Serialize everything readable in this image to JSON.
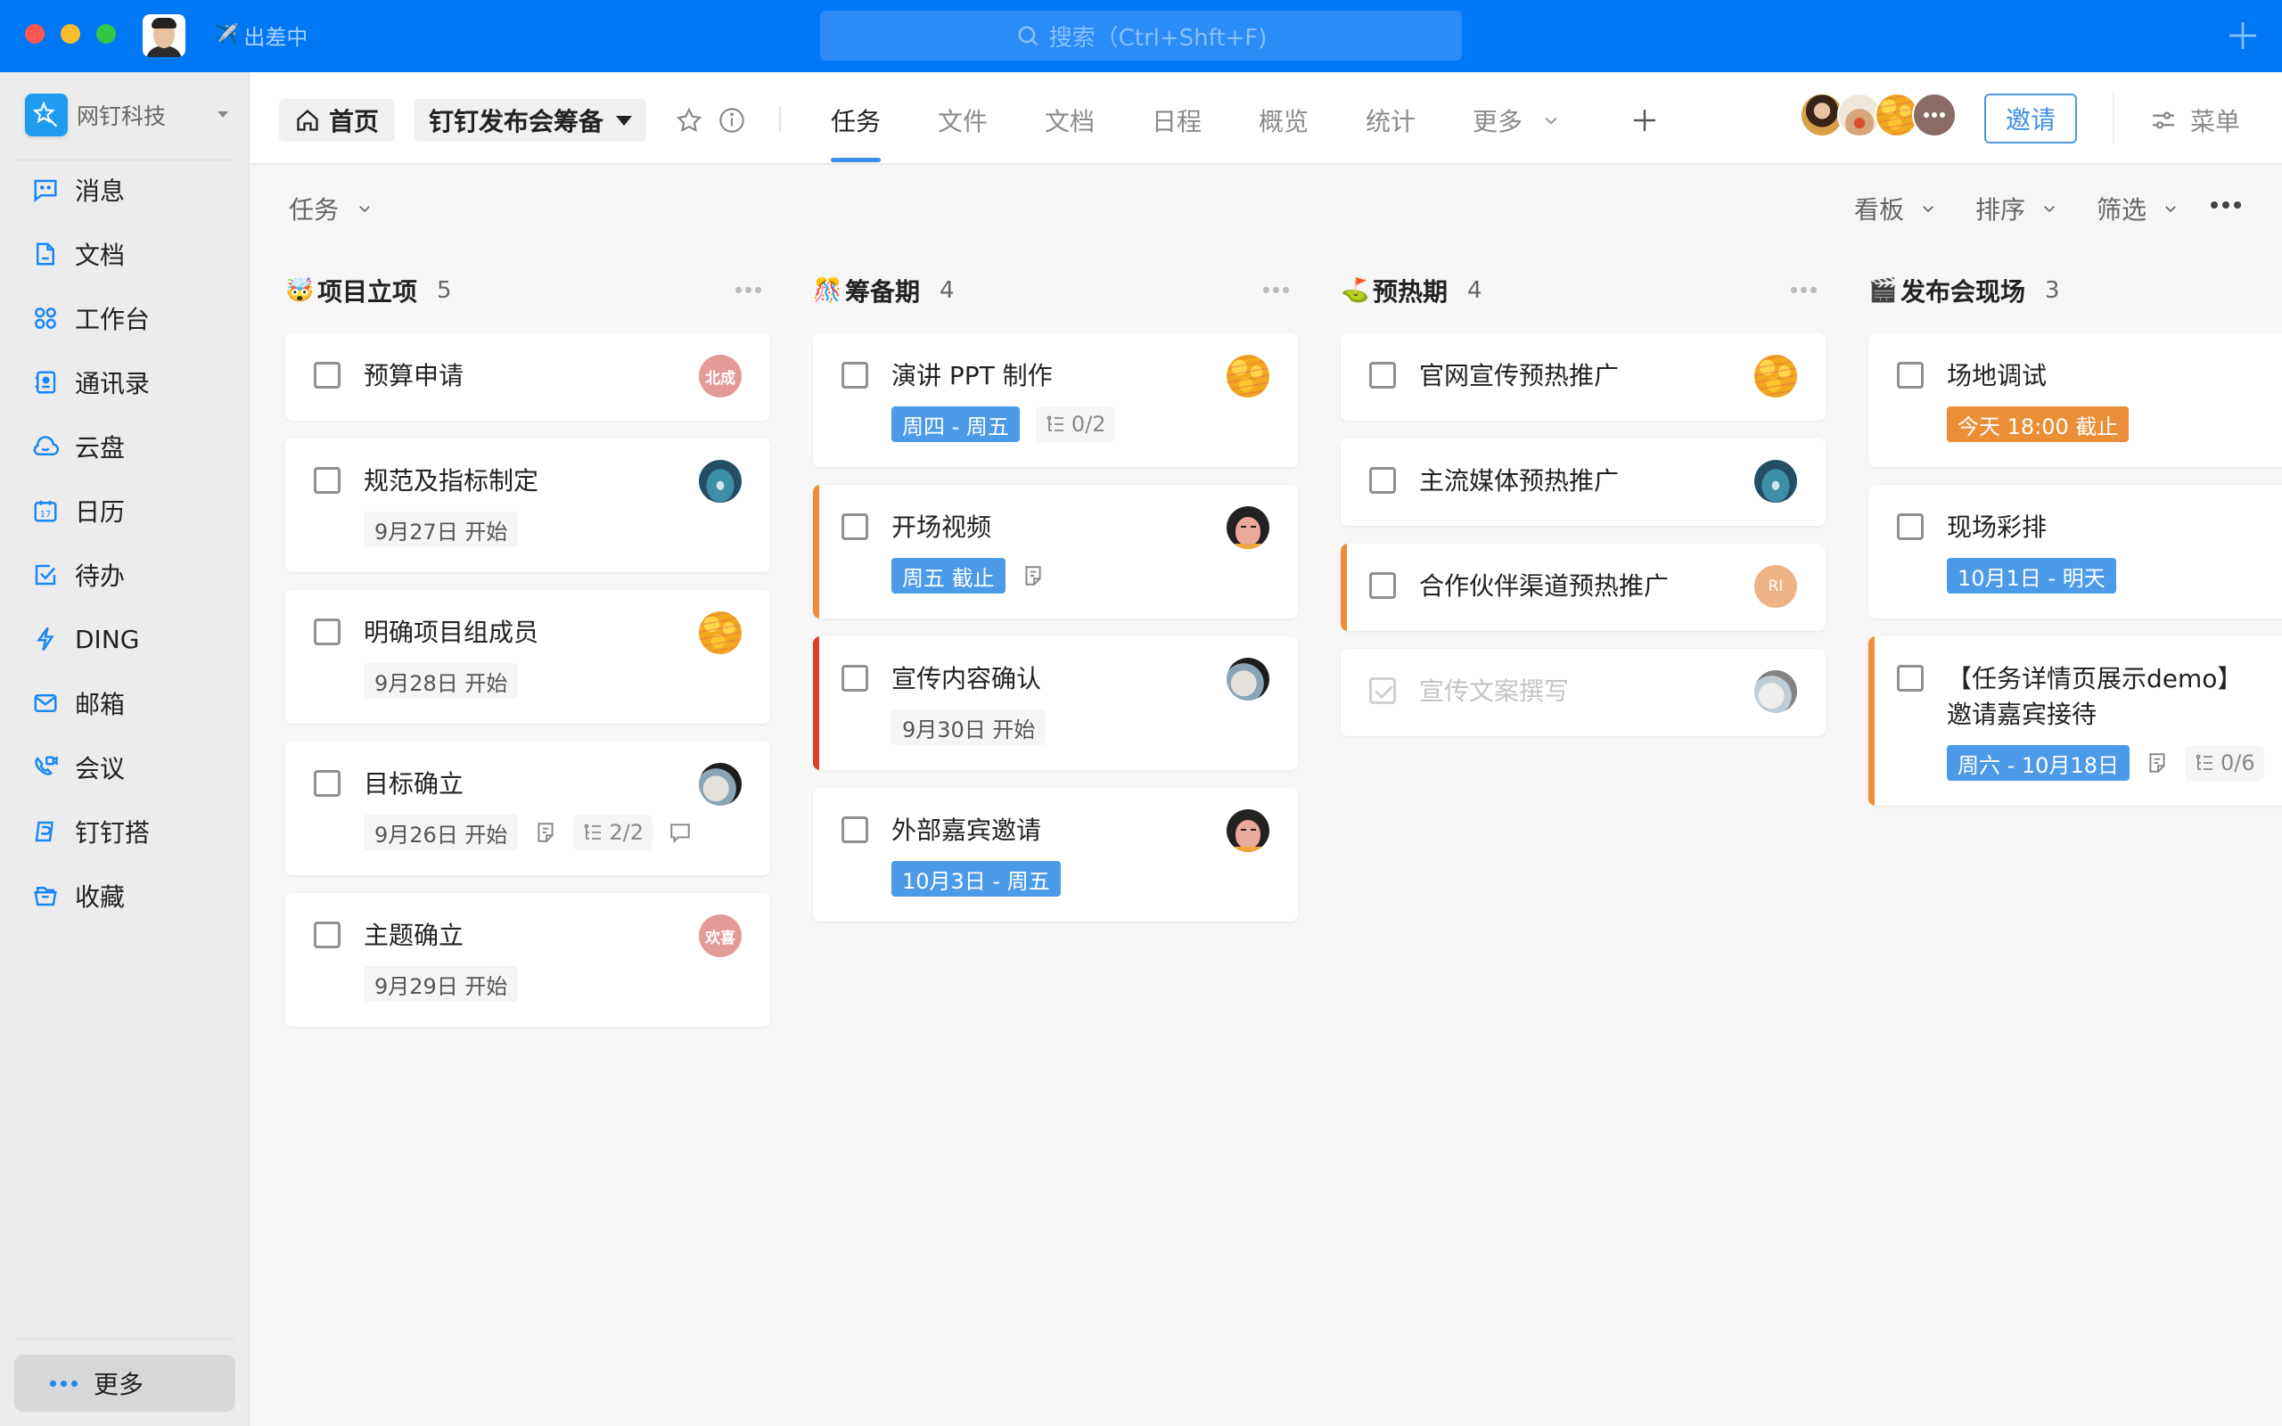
{
  "titlebar": {
    "status_emoji": "✈️",
    "status_text": "出差中",
    "search_placeholder": "搜索（Ctrl+Shft+F)",
    "accent": "#0078f5"
  },
  "sidebar": {
    "org_name": "网钉科技",
    "items": [
      {
        "label": "消息",
        "icon": "message-icon"
      },
      {
        "label": "文档",
        "icon": "document-icon"
      },
      {
        "label": "工作台",
        "icon": "workbench-icon"
      },
      {
        "label": "通讯录",
        "icon": "contacts-icon"
      },
      {
        "label": "云盘",
        "icon": "cloud-drive-icon"
      },
      {
        "label": "日历",
        "icon": "calendar-icon"
      },
      {
        "label": "待办",
        "icon": "todo-icon"
      },
      {
        "label": "DING",
        "icon": "ding-icon"
      },
      {
        "label": "邮箱",
        "icon": "mail-icon"
      },
      {
        "label": "会议",
        "icon": "meeting-icon"
      },
      {
        "label": "钉钉搭",
        "icon": "dingda-icon"
      },
      {
        "label": "收藏",
        "icon": "favorites-icon"
      }
    ],
    "more_label": "更多",
    "calendar_day": "17"
  },
  "header": {
    "home_label": "首页",
    "project_name": "钉钉发布会筹备",
    "tabs": [
      {
        "label": "任务",
        "active": true
      },
      {
        "label": "文件",
        "active": false
      },
      {
        "label": "文档",
        "active": false
      },
      {
        "label": "日程",
        "active": false
      },
      {
        "label": "概览",
        "active": false
      },
      {
        "label": "统计",
        "active": false
      },
      {
        "label": "更多",
        "active": false
      }
    ],
    "invite_label": "邀请",
    "menu_label": "菜单",
    "member_count_shown": 3
  },
  "toolbar": {
    "view_label": "任务",
    "board_label": "看板",
    "sort_label": "排序",
    "filter_label": "筛选"
  },
  "columns": [
    {
      "emoji": "🤯",
      "title": "项目立项",
      "count": "5",
      "cards": [
        {
          "title": "预算申请",
          "avatar": {
            "type": "text",
            "text": "北成",
            "color": "#e59a9a"
          }
        },
        {
          "title": "规范及指标制定",
          "date": {
            "text": "9月27日 开始",
            "style": "gray"
          },
          "avatar": {
            "type": "pool"
          }
        },
        {
          "title": "明确项目组成员",
          "date": {
            "text": "9月28日 开始",
            "style": "gray"
          },
          "avatar": {
            "type": "ducks"
          }
        },
        {
          "title": "目标确立",
          "date": {
            "text": "9月26日 开始",
            "style": "gray"
          },
          "has_note": true,
          "subtasks": "2/2",
          "has_comment": true,
          "avatar": {
            "type": "sketch"
          }
        },
        {
          "title": "主题确立",
          "date": {
            "text": "9月29日 开始",
            "style": "gray"
          },
          "avatar": {
            "type": "text",
            "text": "欢喜",
            "color": "#e59a9a"
          }
        }
      ]
    },
    {
      "emoji": "🎊",
      "title": "筹备期",
      "count": "4",
      "cards": [
        {
          "title": "演讲 PPT 制作",
          "date": {
            "text": "周四 - 周五",
            "style": "blue"
          },
          "subtasks": "0/2",
          "avatar": {
            "type": "ducks"
          }
        },
        {
          "title": "开场视频",
          "priority": "orange",
          "date": {
            "text": "周五 截止",
            "style": "blue"
          },
          "has_note": true,
          "avatar": {
            "type": "girl"
          }
        },
        {
          "title": "宣传内容确认",
          "priority": "red",
          "date": {
            "text": "9月30日 开始",
            "style": "gray"
          },
          "avatar": {
            "type": "sketch"
          }
        },
        {
          "title": "外部嘉宾邀请",
          "date": {
            "text": "10月3日 - 周五",
            "style": "blue"
          },
          "avatar": {
            "type": "girl"
          }
        }
      ]
    },
    {
      "emoji": "⛳",
      "title": "预热期",
      "count": "4",
      "cards": [
        {
          "title": "官网宣传预热推广",
          "avatar": {
            "type": "ducks"
          }
        },
        {
          "title": "主流媒体预热推广",
          "avatar": {
            "type": "pool"
          }
        },
        {
          "title": "合作伙伴渠道预热推广",
          "priority": "orange",
          "avatar": {
            "type": "text",
            "text": "RI",
            "color": "#ecb386"
          }
        },
        {
          "title": "宣传文案撰写",
          "done": true,
          "avatar": {
            "type": "sketch-faded"
          }
        }
      ]
    },
    {
      "emoji": "🎬",
      "title": "发布会现场",
      "count": "3",
      "cards": [
        {
          "title": "场地调试",
          "date": {
            "text": "今天 18:00 截止",
            "style": "orange"
          }
        },
        {
          "title": "现场彩排",
          "date": {
            "text": "10月1日 - 明天",
            "style": "blue"
          }
        },
        {
          "title": "【任务详情页展示demo】邀请嘉宾接待",
          "priority": "orange",
          "date": {
            "text": "周六 - 10月18日",
            "style": "blue"
          },
          "has_note": true,
          "subtasks": "0/6",
          "has_comment": true
        }
      ]
    }
  ],
  "colors": {
    "tag_blue": "#4b9be8",
    "tag_orange": "#ea8f38",
    "priority_orange": "#ea8f38",
    "priority_red": "#d9412b",
    "tab_active_underline": "#3c8fe5"
  }
}
